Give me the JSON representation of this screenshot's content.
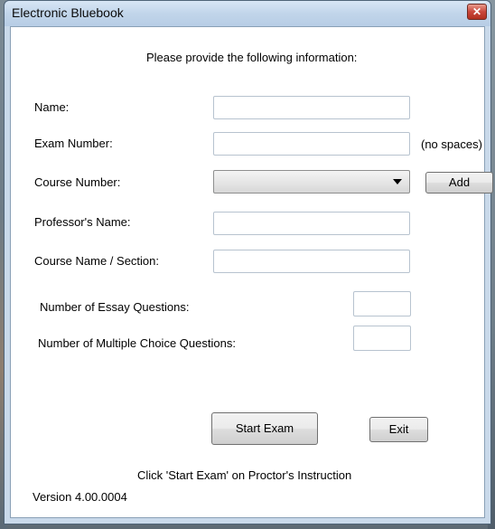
{
  "window": {
    "title": "Electronic Bluebook",
    "close_glyph": "✕"
  },
  "form": {
    "instruction": "Please provide the following information:",
    "name_label": "Name:",
    "name_value": "",
    "exam_number_label": "Exam Number:",
    "exam_number_value": "",
    "exam_number_hint": "(no spaces)",
    "course_number_label": "Course Number:",
    "course_number_value": "",
    "add_label": "Add",
    "professor_label": "Professor's Name:",
    "professor_value": "",
    "course_name_label": "Course Name / Section:",
    "course_name_value": "",
    "essay_label": "Number of Essay Questions:",
    "essay_value": "",
    "mc_label": "Number of Multiple Choice Questions:",
    "mc_value": ""
  },
  "actions": {
    "start_label": "Start Exam",
    "exit_label": "Exit"
  },
  "footer": {
    "note": "Click 'Start Exam' on Proctor's Instruction",
    "version": "Version 4.00.0004"
  },
  "icons": {
    "close": "close-icon",
    "dropdown": "chevron-down-icon"
  }
}
